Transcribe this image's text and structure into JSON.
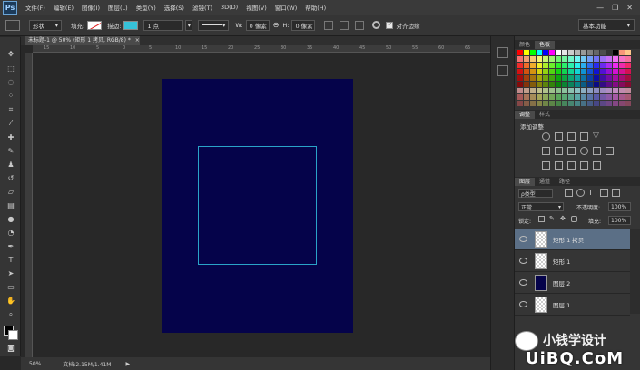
{
  "app": {
    "logo": "Ps"
  },
  "menu": [
    "文件(F)",
    "编辑(E)",
    "图像(I)",
    "图层(L)",
    "类型(Y)",
    "选择(S)",
    "滤镜(T)",
    "3D(D)",
    "视图(V)",
    "窗口(W)",
    "帮助(H)"
  ],
  "window_controls": {
    "minimize": "—",
    "restore": "❐",
    "close": "✕"
  },
  "options": {
    "tool_mode": "形状",
    "fill_label": "填充:",
    "stroke_label": "描边:",
    "stroke_width": "1 点",
    "w_label": "W:",
    "w_value": "0 像素",
    "link": "⊖",
    "h_label": "H:",
    "h_value": "0 像素",
    "align_edges": "对齐边缘",
    "workspace": "基本功能",
    "stroke_color": "#36c1d8"
  },
  "document": {
    "tab_title": "未标题-1 @ 50% (矩形 1 拷贝, RGB/8) *",
    "tab_close": "×",
    "canvas_color": "#05034a",
    "shape_stroke": "#2aa3c8"
  },
  "ruler_ticks": [
    "15",
    "10",
    "5",
    "0",
    "5",
    "10",
    "15",
    "20",
    "25",
    "30",
    "35",
    "40",
    "45",
    "50",
    "55",
    "60",
    "65"
  ],
  "status": {
    "zoom": "50%",
    "doc_info": "文档:2.15M/1.41M"
  },
  "panels": {
    "swatches": {
      "tabs": [
        "颜色",
        "色板"
      ],
      "active": 1
    },
    "adjustments": {
      "tabs": [
        "调整",
        "样式"
      ],
      "active": 0,
      "title": "添加调整"
    },
    "layers": {
      "tabs": [
        "图层",
        "通道",
        "路径"
      ],
      "active": 0,
      "filter_kind": "ρ类型",
      "blend_mode": "正常",
      "opacity_label": "不透明度:",
      "opacity": "100%",
      "lock_label": "锁定:",
      "fill_label": "填充:",
      "fill": "100%",
      "items": [
        {
          "name": "矩形 1 拷贝",
          "selected": true,
          "thumb": "checker"
        },
        {
          "name": "矩形 1",
          "selected": false,
          "thumb": "checker"
        },
        {
          "name": "图层 2",
          "selected": false,
          "thumb": "navy"
        },
        {
          "name": "图层 1",
          "selected": false,
          "thumb": "checker"
        }
      ]
    }
  },
  "watermark": {
    "line1": "小钱学设计",
    "line2": "UiBQ.CoM"
  }
}
